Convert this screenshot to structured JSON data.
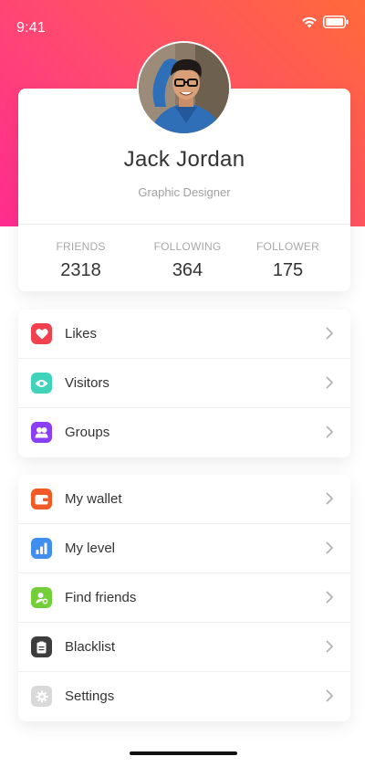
{
  "status_bar": {
    "time": "9:41",
    "wifi_icon": "wifi-icon",
    "battery_icon": "battery-icon"
  },
  "profile": {
    "name": "Jack Jordan",
    "role": "Graphic Designer",
    "avatar_icon": "avatar-photo",
    "stats": [
      {
        "label": "FRIENDS",
        "value": "2318"
      },
      {
        "label": "FOLLOWING",
        "value": "364"
      },
      {
        "label": "FOLLOWER",
        "value": "175"
      }
    ]
  },
  "menu_groups": [
    {
      "items": [
        {
          "label": "Likes",
          "icon": "heart-icon",
          "color": "#f2414e"
        },
        {
          "label": "Visitors",
          "icon": "eye-icon",
          "color": "#3fd3b9"
        },
        {
          "label": "Groups",
          "icon": "people-icon",
          "color": "#8a3ff6"
        }
      ]
    },
    {
      "items": [
        {
          "label": "My wallet",
          "icon": "wallet-icon",
          "color": "#f15a24"
        },
        {
          "label": "My level",
          "icon": "bar-chart-icon",
          "color": "#3f8ef0"
        },
        {
          "label": "Find friends",
          "icon": "find-friends-icon",
          "color": "#72cf3a"
        },
        {
          "label": "Blacklist",
          "icon": "blacklist-icon",
          "color": "#3d3d3d"
        },
        {
          "label": "Settings",
          "icon": "gear-icon",
          "color": "#d9d9d9"
        }
      ]
    }
  ],
  "colors": {
    "gradient_start": "#ff2c8f",
    "gradient_end": "#ff6a3a"
  }
}
